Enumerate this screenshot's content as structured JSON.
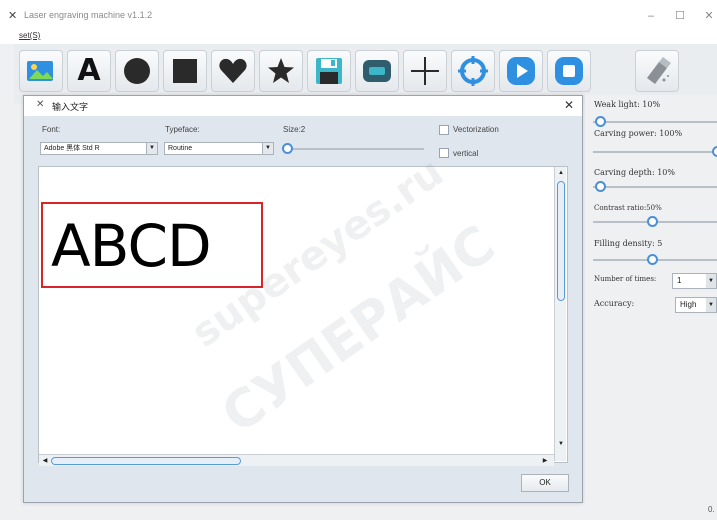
{
  "window": {
    "title": "Laser engraving machine v1.1.2",
    "minimize_glyph": "–",
    "maximize_glyph": "☐",
    "close_glyph": "✕"
  },
  "menubar": {
    "items": [
      {
        "label": "set(S)"
      }
    ]
  },
  "toolbar": {
    "buttons": [
      {
        "icon": "image-icon"
      },
      {
        "icon": "text-icon",
        "glyph": "A"
      },
      {
        "icon": "circle-icon"
      },
      {
        "icon": "square-icon"
      },
      {
        "icon": "heart-icon"
      },
      {
        "icon": "star-icon"
      },
      {
        "icon": "save-icon"
      },
      {
        "icon": "connect-icon"
      },
      {
        "icon": "crosshair-icon"
      },
      {
        "icon": "target-icon"
      },
      {
        "icon": "play-icon"
      },
      {
        "icon": "stop-icon"
      },
      {
        "icon": "eraser-icon"
      }
    ],
    "colors": {
      "blue": "#2f8fe0",
      "dark": "#2a2a2a",
      "teal": "#3bb7c9"
    }
  },
  "dialog": {
    "title": "输入文字",
    "close_glyph": "✕",
    "font_label": "Font:",
    "font_value": "Adobe 黑体 Std R",
    "typeface_label": "Typeface:",
    "typeface_value": "Routine",
    "size_label": "Size:2",
    "vectorization_label": "Vectorization",
    "vertical_label": "vertical",
    "preview_text": "ABCD",
    "ok_label": "OK",
    "accent": "#d9252a"
  },
  "panel": {
    "weak_light": "Weak light: 10%",
    "carving_power": "Carving power: 100%",
    "carving_depth": "Carving depth: 10%",
    "contrast_ratio": "Contrast ratio:50%",
    "filling_density": "Filling density: 5",
    "number_of_times_label": "Number of times:",
    "number_of_times_value": "1",
    "accuracy_label": "Accuracy:",
    "accuracy_value": "High"
  },
  "footer": {
    "corner_value": "0."
  },
  "watermark": {
    "line1": "supereyes.ru",
    "line2": "СУПЕРАЙС"
  }
}
